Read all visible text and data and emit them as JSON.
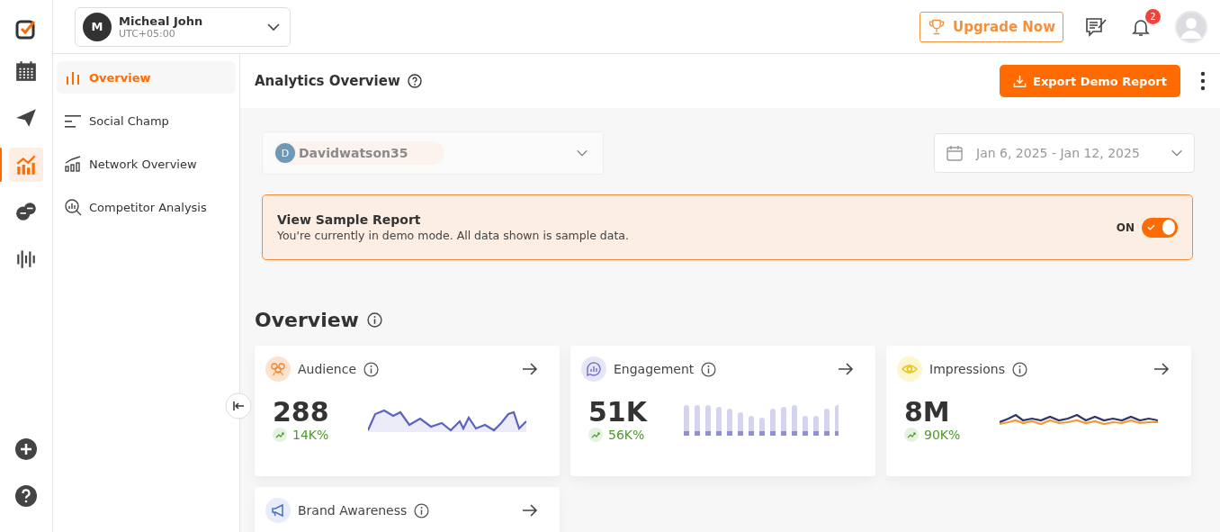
{
  "rail": {
    "items": [
      {
        "selected": false
      },
      {
        "selected": false
      },
      {
        "selected": true
      },
      {
        "selected": false
      },
      {
        "selected": false
      }
    ]
  },
  "account": {
    "initial": "M",
    "name": "Micheal John",
    "timezone": "UTC+05:00"
  },
  "topbar": {
    "upgrade": "Upgrade Now",
    "notifications": "2"
  },
  "sidebar": {
    "items": [
      {
        "label": "Overview",
        "selected": true
      },
      {
        "label": "Social Champ",
        "selected": false
      },
      {
        "label": "Network Overview",
        "selected": false
      },
      {
        "label": "Competitor Analysis",
        "selected": false
      }
    ]
  },
  "header": {
    "title": "Analytics Overview",
    "export": "Export Demo Report"
  },
  "filters": {
    "profile_initial": "D",
    "profile": "Davidwatson35",
    "date_range": "Jan 6, 2025 - Jan 12, 2025"
  },
  "banner": {
    "title": "View Sample Report",
    "text": "You're currently in demo mode. All data shown is sample data.",
    "toggle_label": "ON",
    "on": true
  },
  "overview": {
    "title": "Overview",
    "cards": [
      {
        "title": "Audience",
        "kind": "area",
        "value": "288",
        "change": "14K%"
      },
      {
        "title": "Engagement",
        "kind": "bars",
        "value": "51K",
        "change": "56K%"
      },
      {
        "title": "Impressions",
        "kind": "lines",
        "value": "8M",
        "change": "90K%"
      },
      {
        "title": "Brand Awareness"
      }
    ]
  }
}
